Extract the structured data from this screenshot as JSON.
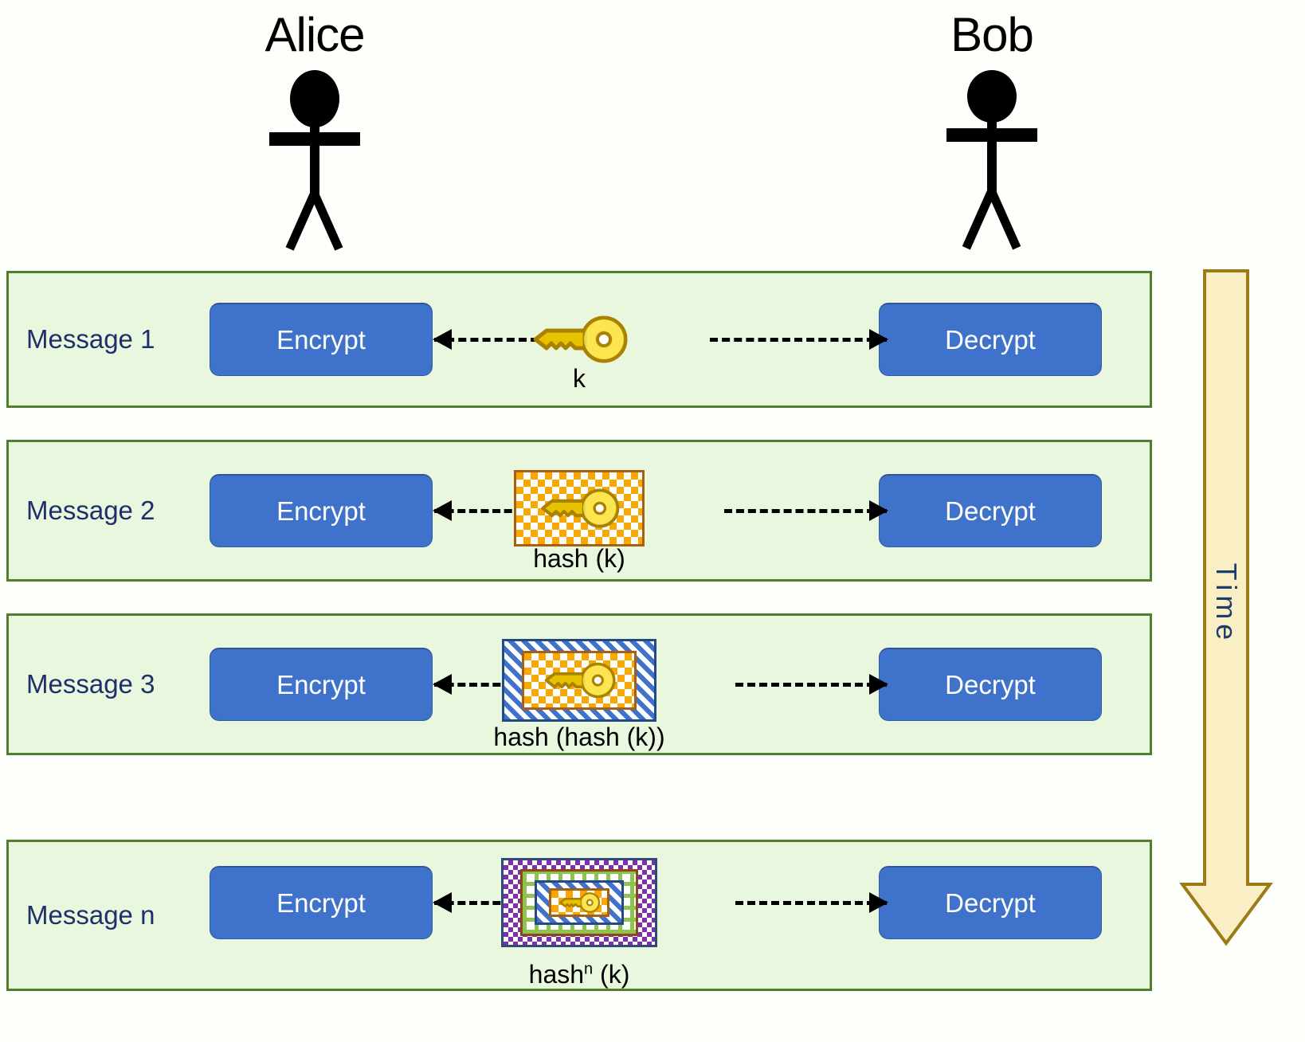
{
  "actors": [
    {
      "name": "Alice",
      "icon": "stick-figure-icon"
    },
    {
      "name": "Bob",
      "icon": "stick-figure-icon"
    }
  ],
  "messages": [
    {
      "label": "Message 1",
      "encrypt_label": "Encrypt",
      "decrypt_label": "Decrypt",
      "payload_caption": "k",
      "payload_caption_sup": "",
      "payload_icon": "key-icon",
      "payload_layers": [],
      "left_arrow_icon": "arrow-left-dashed-icon",
      "right_arrow_icon": "arrow-right-dashed-icon"
    },
    {
      "label": "Message 2",
      "encrypt_label": "Encrypt",
      "decrypt_label": "Decrypt",
      "payload_caption": "hash (k)",
      "payload_caption_sup": "",
      "payload_icon": "key-icon",
      "payload_layers": [
        "orange-checker"
      ],
      "left_arrow_icon": "arrow-left-dashed-icon",
      "right_arrow_icon": "arrow-right-dashed-icon"
    },
    {
      "label": "Message 3",
      "encrypt_label": "Encrypt",
      "decrypt_label": "Decrypt",
      "payload_caption": "hash (hash (k))",
      "payload_caption_sup": "",
      "payload_icon": "key-icon",
      "payload_layers": [
        "blue-diagonal",
        "orange-checker"
      ],
      "left_arrow_icon": "arrow-left-dashed-icon",
      "right_arrow_icon": "arrow-right-dashed-icon"
    },
    {
      "label": "Message n",
      "encrypt_label": "Encrypt",
      "decrypt_label": "Decrypt",
      "payload_caption": "hash",
      "payload_caption_sup": "n",
      "payload_caption_tail": " (k)",
      "payload_icon": "key-icon",
      "payload_layers": [
        "purple-checker",
        "green-grid",
        "blue-diagonal",
        "orange-checker"
      ],
      "left_arrow_icon": "arrow-left-dashed-icon",
      "right_arrow_icon": "arrow-right-dashed-icon"
    }
  ],
  "time_axis": {
    "label": "Time",
    "icon": "arrow-down-icon",
    "direction": "down"
  },
  "colors": {
    "row_background": "#e9f7df",
    "row_border": "#4f7f2e",
    "process_box": "#3f72ca",
    "process_text": "#ffffff",
    "label_text": "#1f2f6b",
    "key_gold": "#f5d800",
    "key_outline": "#a88200",
    "time_arrow_fill": "#faeec4",
    "time_arrow_border": "#9a7b14",
    "page_background": "#fdfffa"
  }
}
